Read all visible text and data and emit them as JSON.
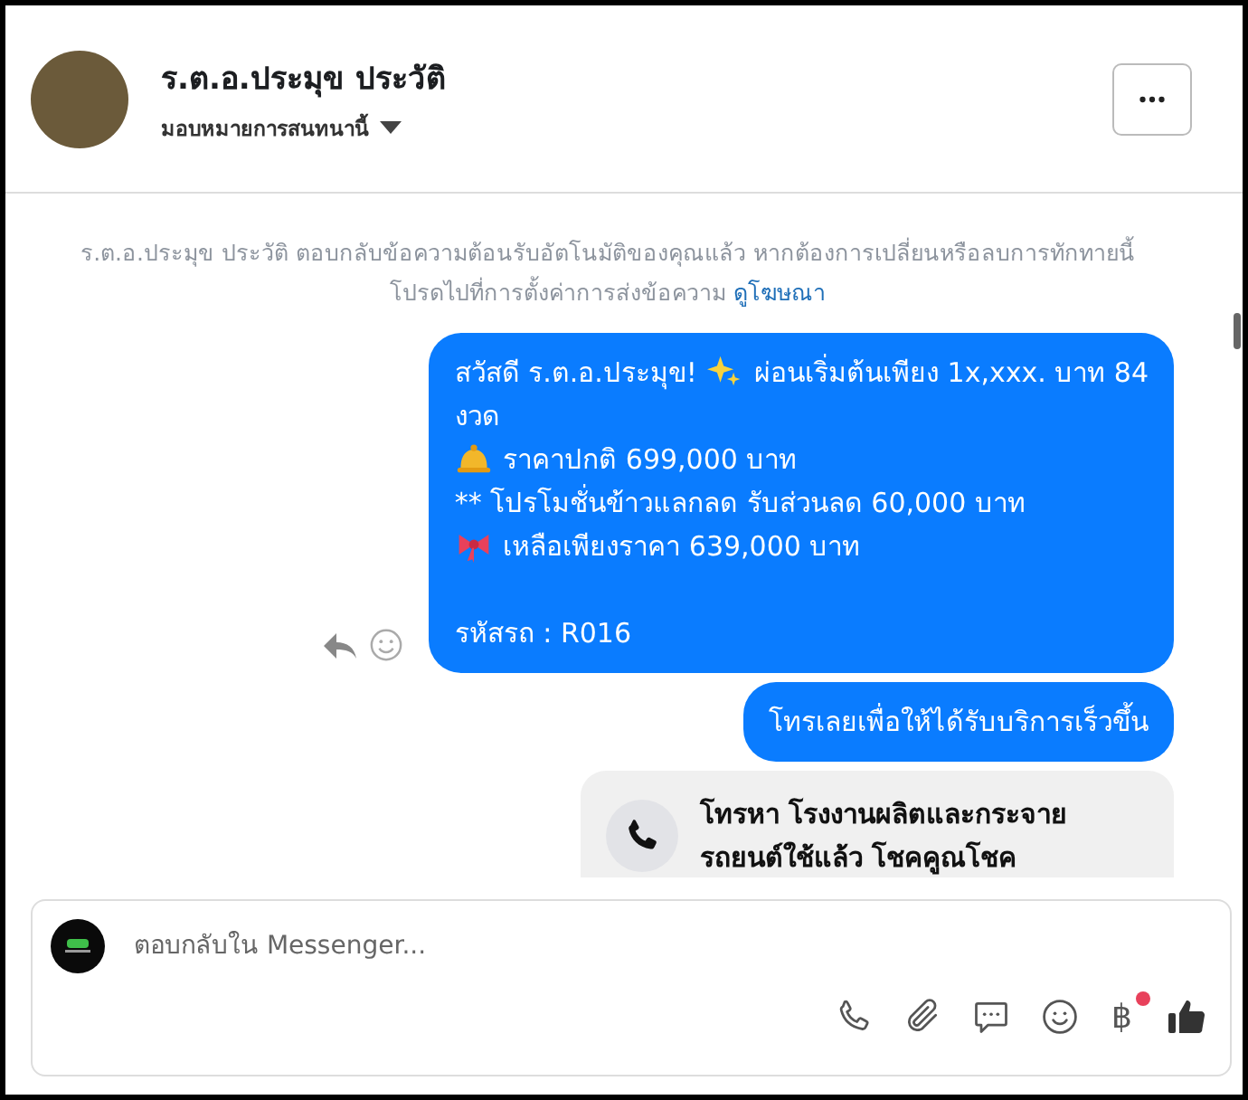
{
  "header": {
    "name": "ร.ต.อ.ประมุข ประวัติ",
    "assign_label": "มอบหมายการสนทนานี้"
  },
  "notice": {
    "text": "ร.ต.อ.ประมุข ประวัติ ตอบกลับข้อความต้อนรับอัตโนมัติของคุณแล้ว หากต้องการเปลี่ยนหรือลบการทักทายนี้ โปรดไปที่การตั้งค่าการส่งข้อความ",
    "link": "ดูโฆษณา"
  },
  "messages": [
    {
      "kind": "bubble",
      "lines": [
        {
          "parts": [
            {
              "kind": "text",
              "text": "สวัสดี ร.ต.อ.ประมุข!"
            },
            {
              "kind": "sparkles"
            },
            {
              "kind": "text",
              "text": "ผ่อนเริ่มต้นเพียง 1x,xxx. บาท 84"
            }
          ]
        },
        {
          "parts": [
            {
              "kind": "text",
              "text": "งวด"
            }
          ]
        },
        {
          "parts": [
            {
              "kind": "bell"
            },
            {
              "kind": "text",
              "text": "ราคาปกติ 699,000 บาท"
            }
          ]
        },
        {
          "parts": [
            {
              "kind": "text",
              "text": "** โปรโมชั่นข้าวแลกลด รับส่วนลด 60,000 บาท"
            }
          ]
        },
        {
          "parts": [
            {
              "kind": "ribbon"
            },
            {
              "kind": "text",
              "text": "เหลือเพียงราคา 639,000 บาท"
            }
          ]
        },
        {
          "spaced": true,
          "parts": [
            {
              "kind": "text",
              "text": " รหัสรถ : R016"
            }
          ]
        }
      ]
    },
    {
      "kind": "bubble",
      "lines": [
        {
          "parts": [
            {
              "kind": "text",
              "text": "โทรเลยเพื่อให้ได้รับบริการเร็วขึ้น"
            }
          ]
        }
      ]
    },
    {
      "kind": "call_card",
      "title": "โทรหา โรงงานผลิตและกระจายรถยนต์ใช้แล้ว โชคคูณโชค"
    }
  ],
  "composer": {
    "placeholder": "ตอบกลับใน Messenger...",
    "currency_symbol": "฿",
    "currency_badge": true
  }
}
